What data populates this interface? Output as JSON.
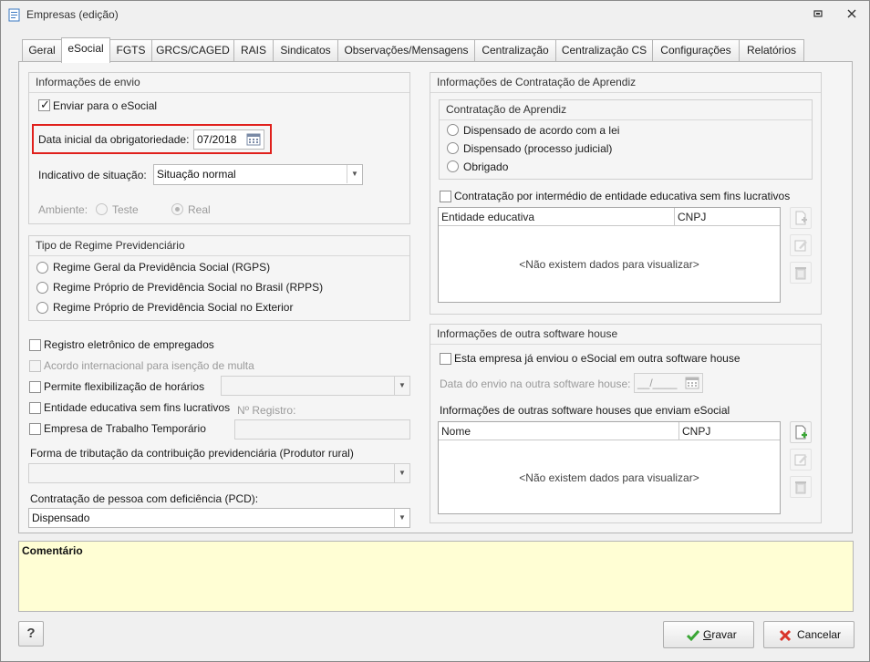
{
  "window": {
    "title": "Empresas (edição)"
  },
  "tabs": [
    {
      "label": "Geral"
    },
    {
      "label": "eSocial"
    },
    {
      "label": "FGTS"
    },
    {
      "label": "GRCS/CAGED"
    },
    {
      "label": "RAIS"
    },
    {
      "label": "Sindicatos"
    },
    {
      "label": "Observações/Mensagens"
    },
    {
      "label": "Centralização"
    },
    {
      "label": "Centralização CS"
    },
    {
      "label": "Configurações"
    },
    {
      "label": "Relatórios"
    }
  ],
  "envio": {
    "title": "Informações de envio",
    "enviar_label": "Enviar para o eSocial",
    "enviar_checked": true,
    "data_label": "Data inicial da obrigatoriedade:",
    "data_value": "07/2018",
    "situacao_label": "Indicativo de situação:",
    "situacao_value": "Situação normal",
    "ambiente_label": "Ambiente:",
    "ambiente_teste": "Teste",
    "ambiente_real": "Real"
  },
  "regime": {
    "title": "Tipo de Regime Previdenciário",
    "options": [
      {
        "label": "Regime Geral da Previdência Social (RGPS)"
      },
      {
        "label": "Regime Próprio de Previdência Social no Brasil (RPPS)"
      },
      {
        "label": "Regime Próprio de Previdência Social no Exterior"
      }
    ]
  },
  "options": {
    "registro": "Registro eletrônico de empregados",
    "acordo": "Acordo internacional para isenção de multa",
    "flex": "Permite flexibilização de horários",
    "entidade": "Entidade educativa sem fins lucrativos",
    "registro_label": "Nº Registro:",
    "temporario": "Empresa de Trabalho Temporário",
    "tributacao_label": "Forma de tributação da contribuição previdenciária (Produtor rural)",
    "pcd_label": "Contratação de pessoa com deficiência (PCD):",
    "pcd_value": "Dispensado"
  },
  "aprendiz": {
    "title": "Informações de Contratação de Aprendiz",
    "sub_title": "Contratação de Aprendiz",
    "radio_options": [
      {
        "label": "Dispensado de acordo com a lei"
      },
      {
        "label": "Dispensado (processo judicial)"
      },
      {
        "label": "Obrigado"
      }
    ],
    "intermedio_label": "Contratação por intermédio de entidade educativa sem fins lucrativos",
    "grid_columns": [
      "Entidade educativa",
      "CNPJ"
    ],
    "grid_empty": "<Não existem dados para visualizar>"
  },
  "software": {
    "title": "Informações de outra software house",
    "enviou_label": "Esta empresa já enviou o eSocial em outra software house",
    "data_label": "Data do envio na outra software house:",
    "data_value": "__/____",
    "outras_label": "Informações de outras software houses que enviam eSocial",
    "grid_columns": [
      "Nome",
      "CNPJ"
    ],
    "grid_empty": "<Não existem dados para visualizar>"
  },
  "comment": {
    "label": "Comentário"
  },
  "footer": {
    "help": "?",
    "gravar": "Gravar",
    "gravar_hotkey": "G",
    "gravar_rest": "ravar",
    "cancelar": "Cancelar"
  },
  "colors": {
    "highlight": "#e0201c",
    "comment_bg": "#fffed4",
    "accent_green": "#3aa635",
    "accent_red": "#d9342b"
  }
}
